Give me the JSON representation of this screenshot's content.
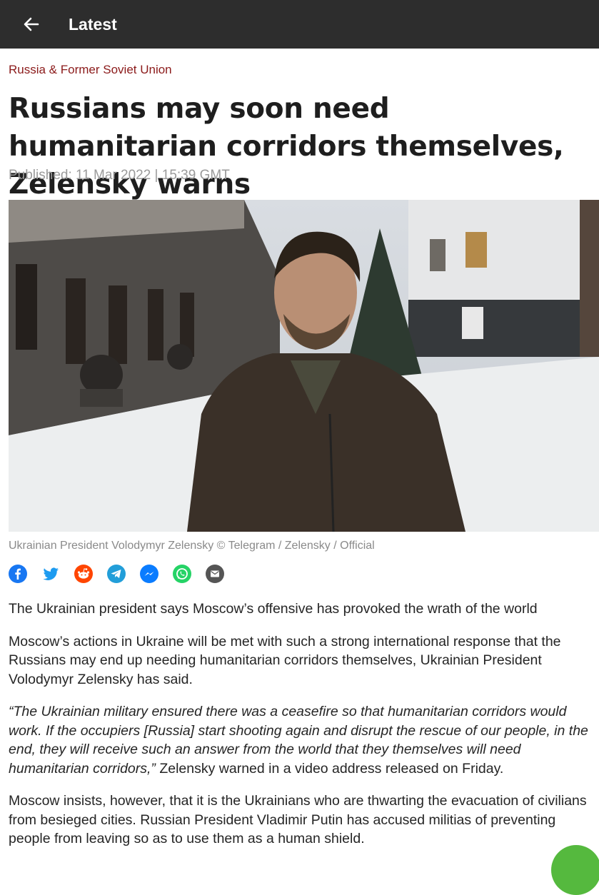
{
  "header": {
    "back_icon": "arrow-left-icon",
    "title": "Latest"
  },
  "article": {
    "section": "Russia & Former Soviet Union",
    "headline": "Russians may soon need humanitarian corridors themselves, Zelensky warns",
    "published": "Published: 11 Mar 2022 | 15:39 GMT",
    "caption": "Ukrainian President Volodymyr Zelensky © Telegram / Zelensky / Official",
    "lead": "The Ukrainian president says Moscow’s offensive has provoked the wrath of the world",
    "para1": "Moscow’s actions in Ukraine will be met with such a strong international response that the Russians may end up needing humanitarian corridors themselves, Ukrainian President Volodymyr Zelensky has said.",
    "quote": "“The Ukrainian military ensured there was a ceasefire so that humanitarian corridors would work. If the occupiers [Russia] start shooting again and disrupt the rescue of our people, in the end, they will receive such an answer from the world that they themselves will need humanitarian corridors,”",
    "quote_tail": " Zelensky warned in a video address released on Friday.",
    "para3": "Moscow insists, however, that it is the Ukrainians who are thwarting the evacuation of civilians from besieged cities. Russian President Vladimir Putin has accused militias of preventing people from leaving so as to use them as a human shield."
  },
  "share": [
    {
      "name": "facebook-icon",
      "color": "#1877f2"
    },
    {
      "name": "twitter-icon",
      "color": "#1d9bf0"
    },
    {
      "name": "reddit-icon",
      "color": "#ff4500"
    },
    {
      "name": "telegram-icon",
      "color": "#229ed9"
    },
    {
      "name": "messenger-icon",
      "color": "#0a7cff"
    },
    {
      "name": "whatsapp-icon",
      "color": "#25d366"
    },
    {
      "name": "email-icon",
      "color": "#555555"
    }
  ],
  "colors": {
    "topbar": "#2d2d2d",
    "section": "#8b1a1a",
    "fab": "#55b93e"
  }
}
